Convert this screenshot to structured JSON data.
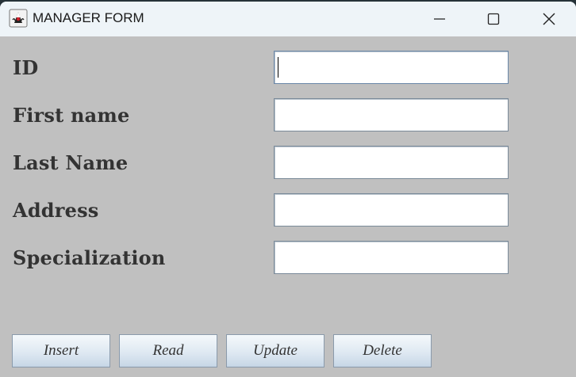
{
  "window": {
    "title": "MANAGER FORM",
    "app_icon": "java-duke-icon"
  },
  "titlebar_controls": [
    "minimize-icon",
    "maximize-icon",
    "close-icon"
  ],
  "form": {
    "fields": [
      {
        "label": "ID",
        "value": ""
      },
      {
        "label": "First name",
        "value": ""
      },
      {
        "label": "Last Name",
        "value": ""
      },
      {
        "label": "Address",
        "value": ""
      },
      {
        "label": "Specialization",
        "value": ""
      }
    ]
  },
  "buttons": {
    "insert": "Insert",
    "read": "Read",
    "update": "Update",
    "delete": "Delete"
  },
  "colors": {
    "background": "#c0c0c0",
    "titlebar": "#eef4f8",
    "label_text": "#333333"
  }
}
